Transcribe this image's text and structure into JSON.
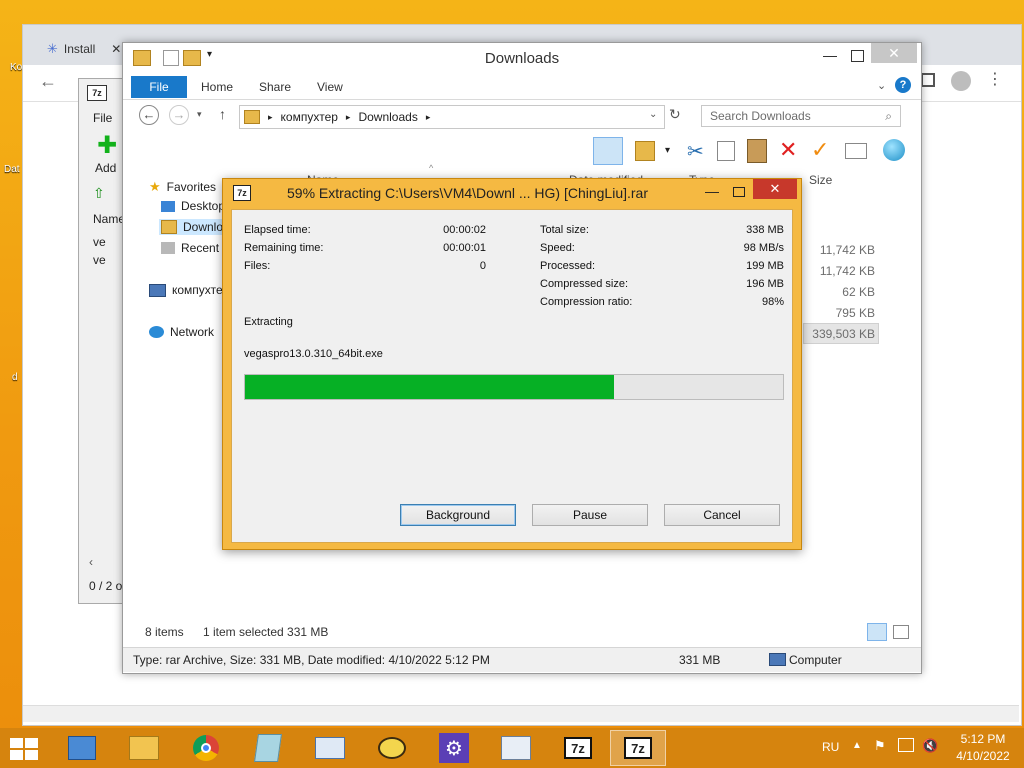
{
  "desktop": {
    "icons": [
      {
        "label": "Ko"
      },
      {
        "label": "Dat"
      },
      {
        "label": "d"
      }
    ]
  },
  "browser": {
    "tabs": [
      {
        "label": "Install"
      }
    ]
  },
  "seven_zip_fm": {
    "title_icon": "7z",
    "menu_file": "File",
    "add_label": "Add",
    "column_name": "Name",
    "rows": [
      "ve",
      "ve"
    ],
    "status": "0 / 2 o"
  },
  "explorer": {
    "title": "Downloads",
    "ribbon": {
      "file": "File",
      "home": "Home",
      "share": "Share",
      "view": "View"
    },
    "address": {
      "root": "компухтер",
      "folder": "Downloads"
    },
    "search_placeholder": "Search Downloads",
    "columns": {
      "name": "Name",
      "date": "Date modified",
      "type": "Type",
      "size": "Size"
    },
    "nav": {
      "favorites": "Favorites",
      "desktop": "Desktop",
      "downloads": "Downlo",
      "recent": "Recent p",
      "computer": "компухте",
      "network": "Network"
    },
    "sizes": [
      "11,742 KB",
      "11,742 KB",
      "62 KB",
      "795 KB",
      "339,503 KB"
    ],
    "status_items": "8 items",
    "status_selected": "1 item selected  331 MB",
    "details_bar": {
      "info": "Type: rar Archive, Size: 331 MB, Date modified: 4/10/2022 5:12 PM",
      "size": "331 MB",
      "location": "Computer"
    }
  },
  "dialog": {
    "title_icon": "7z",
    "title": "59% Extracting C:\\Users\\VM4\\Downl ... HG) [ChingLiu].rar",
    "left": [
      {
        "label": "Elapsed time:",
        "value": "00:00:02"
      },
      {
        "label": "Remaining time:",
        "value": "00:00:01"
      },
      {
        "label": "Files:",
        "value": "0"
      }
    ],
    "right": [
      {
        "label": "Total size:",
        "value": "338 MB"
      },
      {
        "label": "Speed:",
        "value": "98 MB/s"
      },
      {
        "label": "Processed:",
        "value": "199 MB"
      },
      {
        "label": "Compressed size:",
        "value": "196 MB"
      },
      {
        "label": "Compression ratio:",
        "value": "98%"
      }
    ],
    "operation": "Extracting",
    "current_file": "vegaspro13.0.310_64bit.exe",
    "progress_fraction": 0.685,
    "buttons": {
      "background": "Background",
      "pause": "Pause",
      "cancel": "Cancel"
    }
  },
  "taskbar": {
    "lang": "RU",
    "time": "5:12 PM",
    "date": "4/10/2022",
    "apps": [
      {
        "icon": "7z"
      },
      {
        "icon": "7z"
      }
    ]
  },
  "colors": {
    "progress": "#06b025",
    "dialog_frame": "#f5b942",
    "ribbon_file": "#1979ca",
    "taskbar": "#d6840e"
  }
}
